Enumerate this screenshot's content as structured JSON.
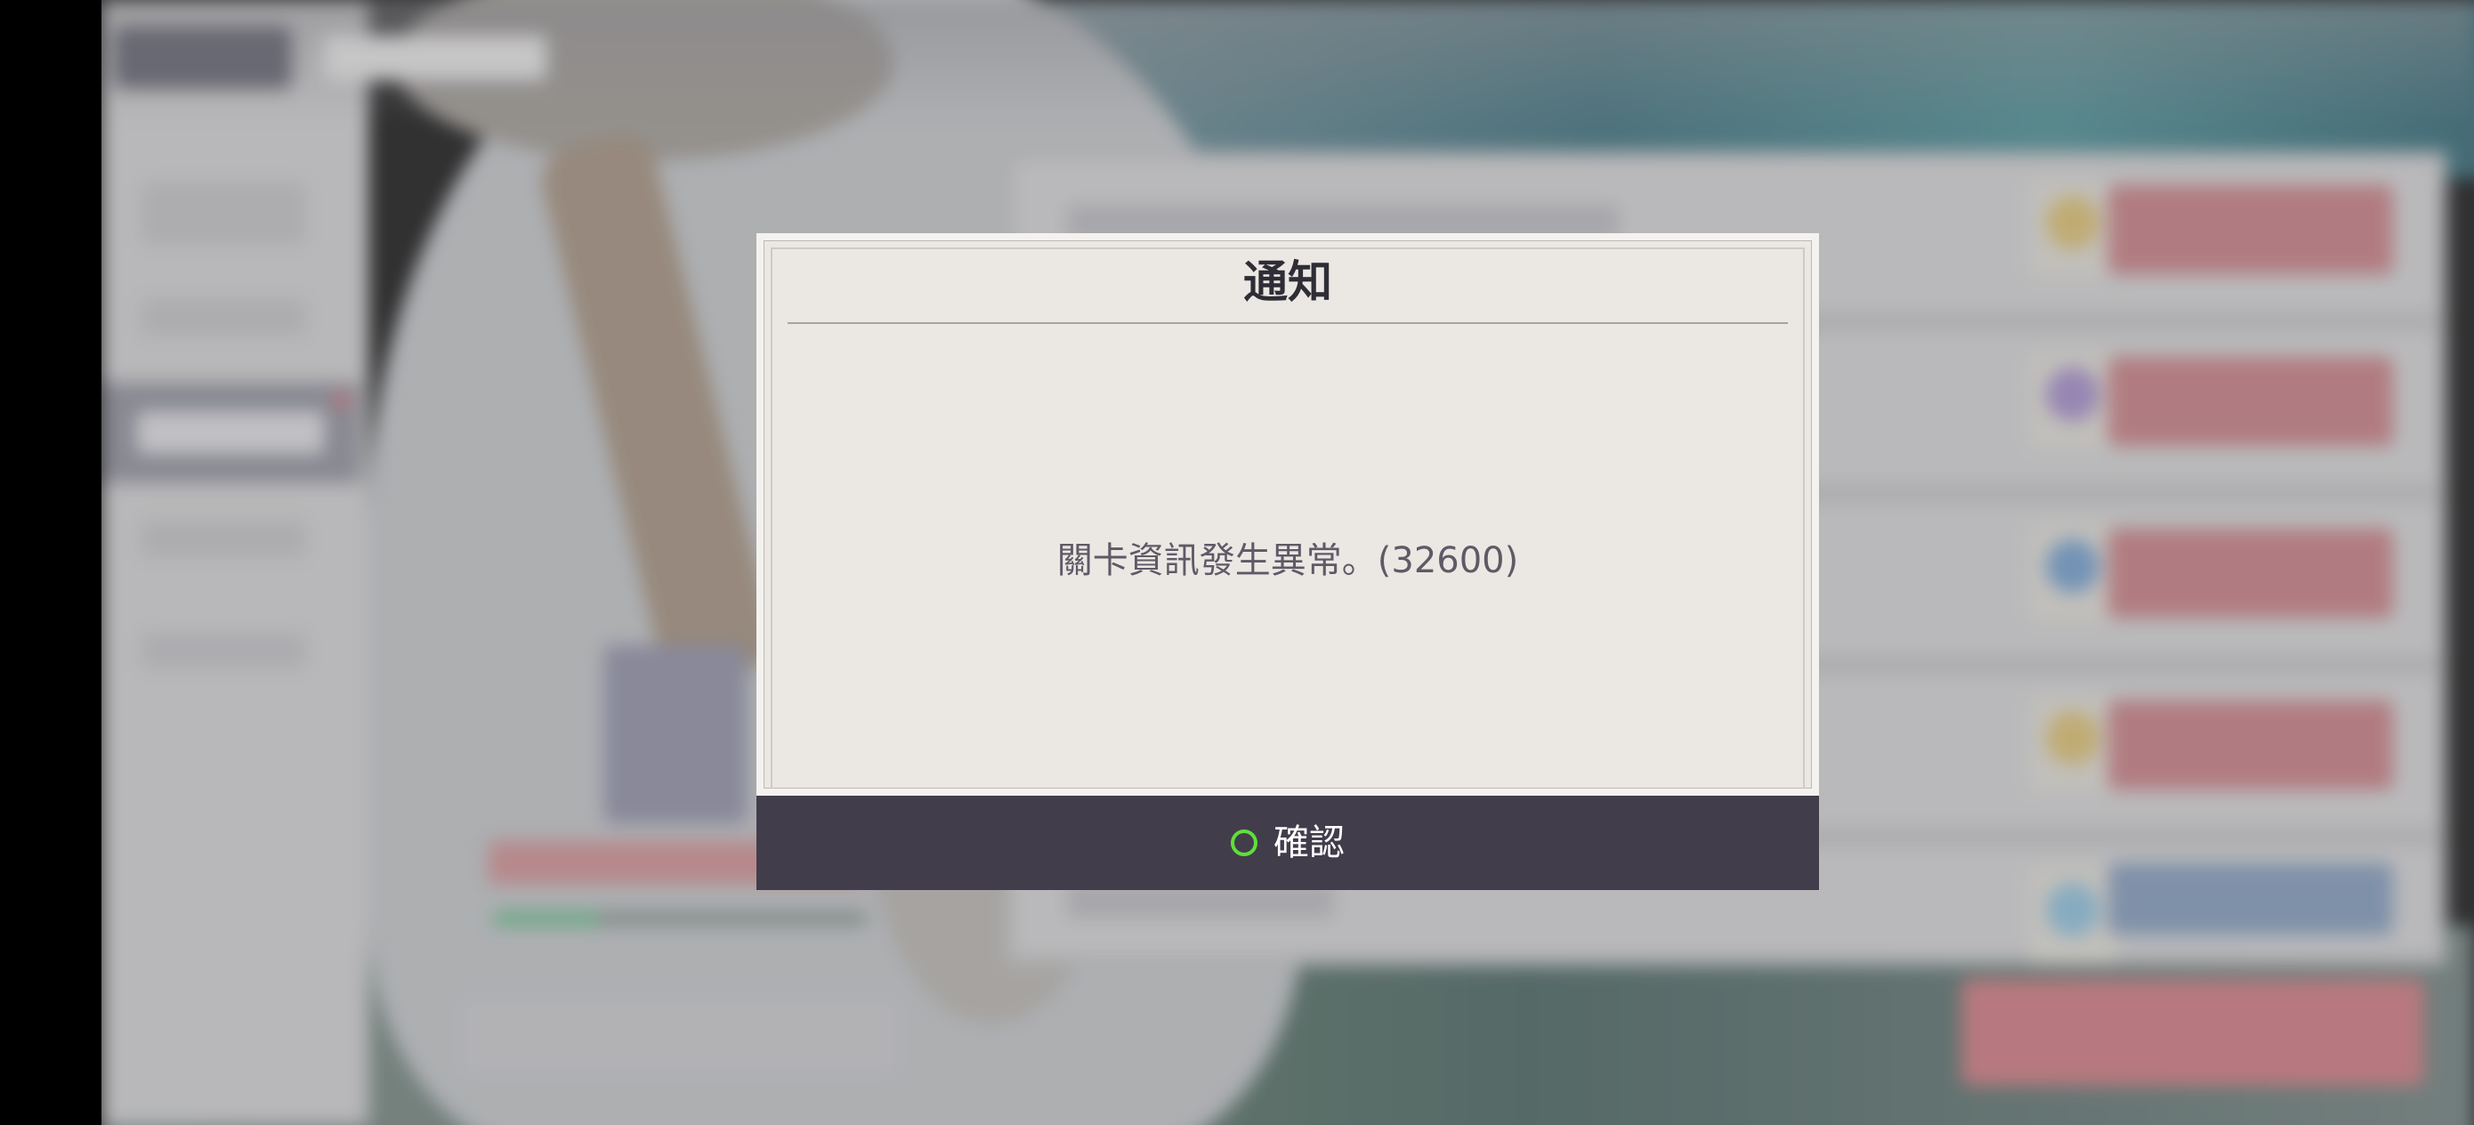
{
  "dialog": {
    "title": "通知",
    "message": "關卡資訊發生異常。(32600)",
    "confirm_label": "確認",
    "confirm_icon": "circle-icon"
  },
  "colors": {
    "confirm_bar": "#423d4b",
    "confirm_icon": "#5fdf3a",
    "dialog_bg": "#ebe8e4",
    "row_button": "#cf7a80"
  }
}
